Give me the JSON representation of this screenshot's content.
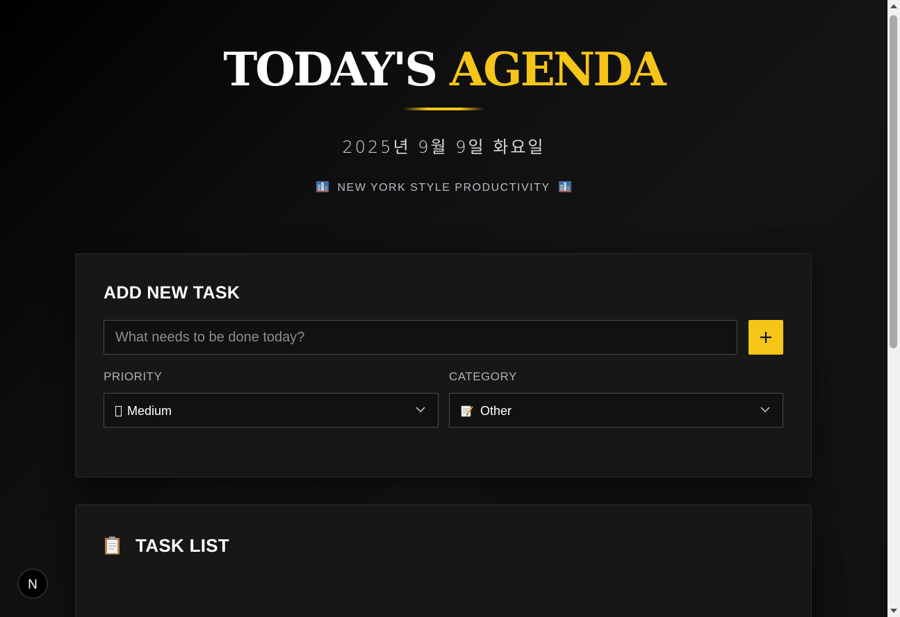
{
  "header": {
    "title_part1": "TODAY'S",
    "title_part2": "AGENDA",
    "date": "2025년 9월 9일 화요일",
    "tagline": "NEW YORK STYLE PRODUCTIVITY",
    "tagline_icon": "cityscape-icon"
  },
  "add_task": {
    "heading": "ADD NEW TASK",
    "input_value": "",
    "input_placeholder": "What needs to be done today?",
    "add_button_icon": "plus-icon",
    "priority": {
      "label": "PRIORITY",
      "selected": "Medium",
      "icon": "missing-glyph-icon"
    },
    "category": {
      "label": "CATEGORY",
      "selected": "Other",
      "icon": "memo-icon"
    }
  },
  "task_list": {
    "heading": "TASK LIST",
    "icon": "clipboard-icon"
  },
  "colors": {
    "accent": "#f5c518",
    "background": "#0a0a0a",
    "card": "#181818"
  },
  "dev_badge": {
    "letter": "N"
  }
}
